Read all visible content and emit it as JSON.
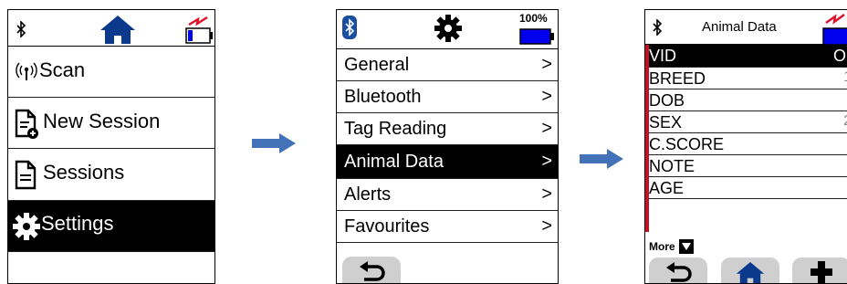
{
  "screen1": {
    "menu": [
      {
        "label": "Scan",
        "icon": "radio-waves-icon"
      },
      {
        "label": "New Session",
        "icon": "new-document-icon"
      },
      {
        "label": "Sessions",
        "icon": "document-icon"
      },
      {
        "label": "Settings",
        "icon": "gear-icon",
        "selected": true
      }
    ]
  },
  "screen2": {
    "battery": "100%",
    "menu": [
      {
        "label": "General"
      },
      {
        "label": "Bluetooth"
      },
      {
        "label": "Tag Reading"
      },
      {
        "label": "Animal Data",
        "selected": true
      },
      {
        "label": "Alerts"
      },
      {
        "label": "Favourites"
      }
    ]
  },
  "screen3": {
    "title": "Animal Data",
    "rows": [
      {
        "label": "VID",
        "value": "Or",
        "selected": true
      },
      {
        "label": "BREED",
        "value": "1"
      },
      {
        "label": "DOB",
        "value": ""
      },
      {
        "label": "SEX",
        "value": "2"
      },
      {
        "label": "C.SCORE",
        "value": ""
      },
      {
        "label": "NOTE",
        "value": ""
      },
      {
        "label": "AGE",
        "value": ""
      }
    ],
    "more": "More"
  },
  "colors": {
    "accent": "#1a4fa0",
    "battery_blue": "#0000ee",
    "charge_red": "#e0102a",
    "flow_arrow": "#4472b8"
  }
}
